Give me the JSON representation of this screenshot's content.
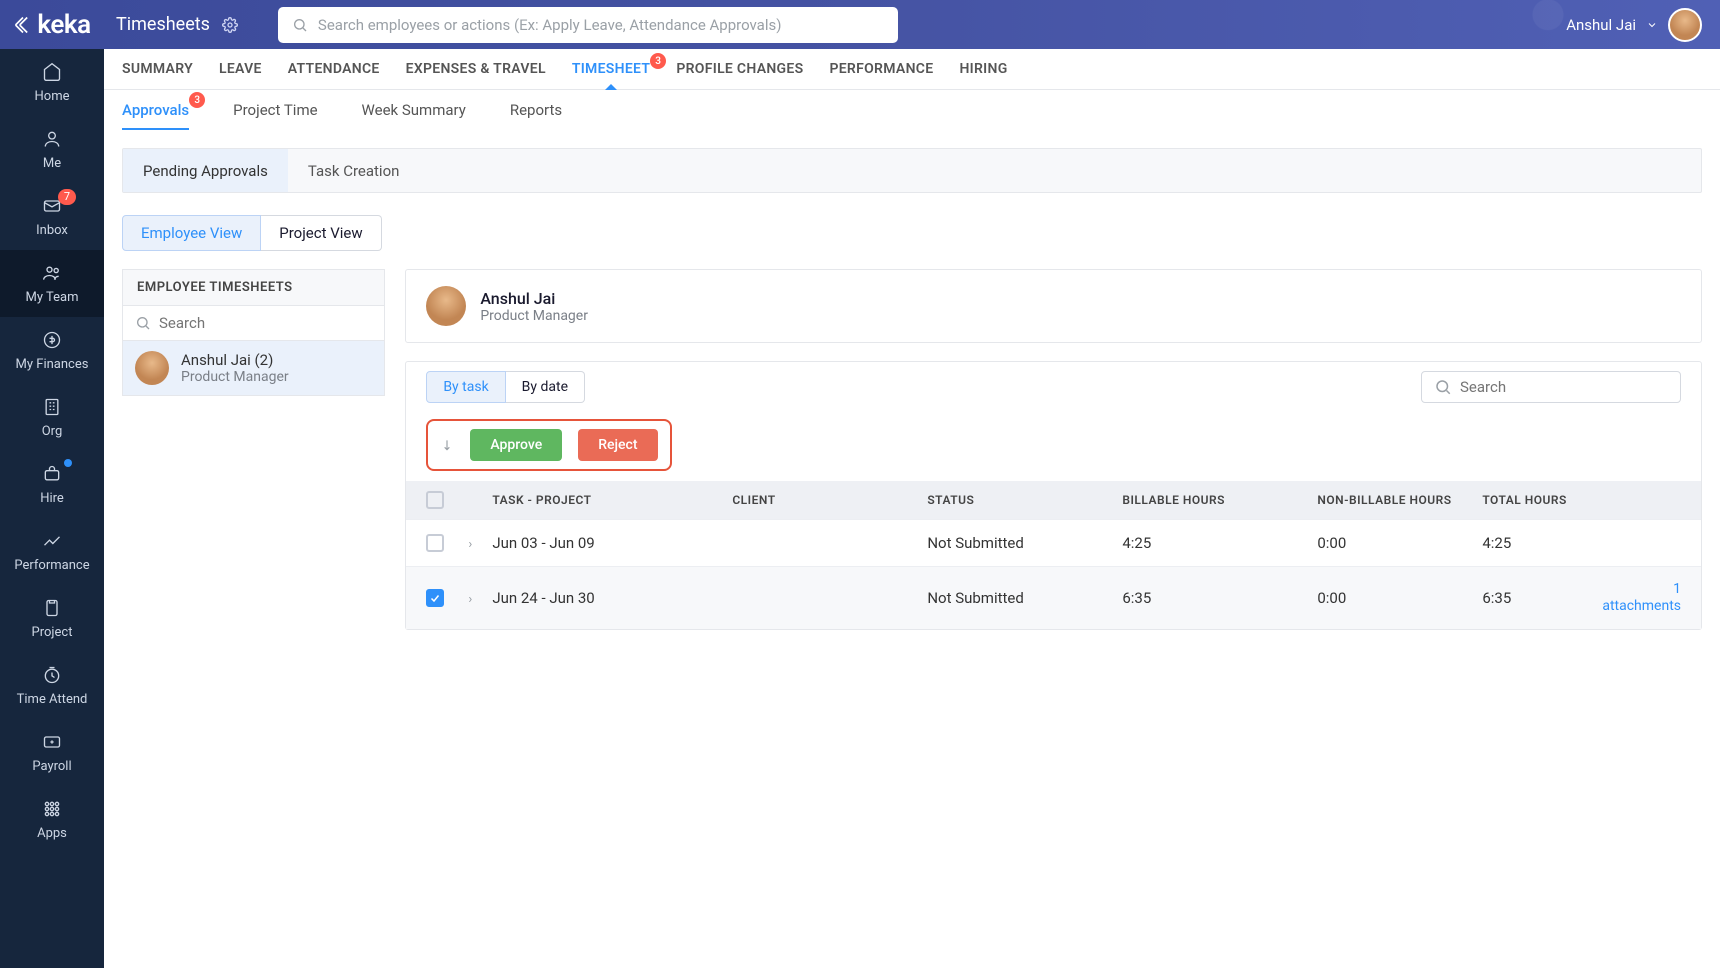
{
  "header": {
    "logo_text": "keka",
    "page_title": "Timesheets",
    "search_placeholder": "Search employees or actions (Ex: Apply Leave, Attendance Approvals)",
    "user_name": "Anshul Jai"
  },
  "sidebar": {
    "items": [
      {
        "label": "Home",
        "icon": "home"
      },
      {
        "label": "Me",
        "icon": "user"
      },
      {
        "label": "Inbox",
        "icon": "mail",
        "badge": "7"
      },
      {
        "label": "My Team",
        "icon": "team",
        "active": true
      },
      {
        "label": "My Finances",
        "icon": "finance"
      },
      {
        "label": "Org",
        "icon": "org"
      },
      {
        "label": "Hire",
        "icon": "hire",
        "dot": true
      },
      {
        "label": "Performance",
        "icon": "perf"
      },
      {
        "label": "Project",
        "icon": "project"
      },
      {
        "label": "Time Attend",
        "icon": "clock"
      },
      {
        "label": "Payroll",
        "icon": "payroll"
      },
      {
        "label": "Apps",
        "icon": "apps"
      }
    ]
  },
  "primary_tabs": [
    {
      "label": "SUMMARY"
    },
    {
      "label": "LEAVE"
    },
    {
      "label": "ATTENDANCE"
    },
    {
      "label": "EXPENSES & TRAVEL"
    },
    {
      "label": "TIMESHEET",
      "active": true,
      "badge": "3"
    },
    {
      "label": "PROFILE CHANGES"
    },
    {
      "label": "PERFORMANCE"
    },
    {
      "label": "HIRING"
    }
  ],
  "secondary_tabs": [
    {
      "label": "Approvals",
      "active": true,
      "badge": "3"
    },
    {
      "label": "Project Time"
    },
    {
      "label": "Week Summary"
    },
    {
      "label": "Reports"
    }
  ],
  "approval_tabs": {
    "pending": "Pending Approvals",
    "task_creation": "Task Creation"
  },
  "view_toggles": {
    "employee": "Employee View",
    "project": "Project View"
  },
  "employee_panel": {
    "title": "EMPLOYEE TIMESHEETS",
    "search_placeholder": "Search",
    "employee": {
      "name": "Anshul Jai (2)",
      "role": "Product Manager"
    }
  },
  "profile": {
    "name": "Anshul Jai",
    "role": "Product Manager"
  },
  "filter_toggles": {
    "by_task": "By task",
    "by_date": "By date"
  },
  "table_search_placeholder": "Search",
  "action_buttons": {
    "approve": "Approve",
    "reject": "Reject"
  },
  "columns": {
    "task": "TASK - PROJECT",
    "client": "CLIENT",
    "status": "STATUS",
    "billable": "BILLABLE HOURS",
    "nonbillable": "NON-BILLABLE HOURS",
    "total": "TOTAL HOURS"
  },
  "rows": [
    {
      "range": "Jun 03 - Jun 09",
      "client": "",
      "status": "Not Submitted",
      "billable": "4:25",
      "non_billable": "0:00",
      "total": "4:25",
      "checked": false,
      "attachments": ""
    },
    {
      "range": "Jun 24 - Jun 30",
      "client": "",
      "status": "Not Submitted",
      "billable": "6:35",
      "non_billable": "0:00",
      "total": "6:35",
      "checked": true,
      "attachments_count": "1",
      "attachments_label": "attachments"
    }
  ]
}
